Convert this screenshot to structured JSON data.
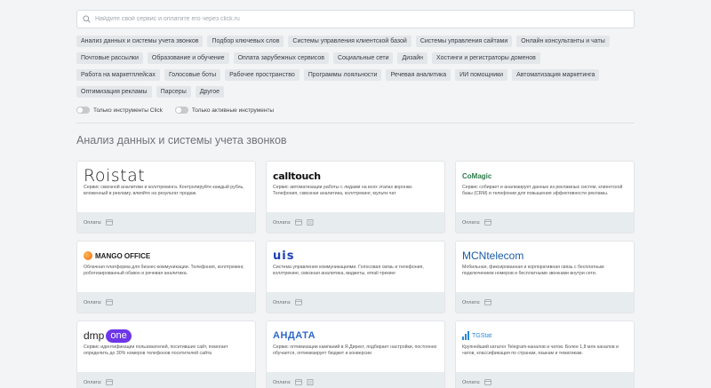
{
  "search": {
    "placeholder": "Найдите свой сервис и оплатите его через click.ru"
  },
  "tags": [
    "Анализ данных и системы учета звонков",
    "Подбор ключевых слов",
    "Системы управления клиентской базой",
    "Системы управления сайтами",
    "Онлайн консультанты и чаты",
    "Почтовые рассылки",
    "Образование и обучение",
    "Оплата зарубежных сервисов",
    "Социальные сети",
    "Дизайн",
    "Хостинги и регистраторы доменов",
    "Работа на маркетплейсах",
    "Голосовые боты",
    "Рабочее пространство",
    "Программы лояльности",
    "Речевая аналитика",
    "ИИ помощники",
    "Автоматизация маркетинга",
    "Оптимизация рекламы",
    "Парсеры",
    "Другое"
  ],
  "toggles": {
    "click_only": "Только инструменты Click",
    "active_only": "Только активные инструменты"
  },
  "section_title": "Анализ данных и системы учета звонков",
  "pay_label": "Оплата:",
  "cards": [
    {
      "logo": "Roistat",
      "desc": "Сервис сквозной аналитики и коллтрекинга. Контролируйте каждый рубль, вложенный в рекламу, влияйте на результат продаж."
    },
    {
      "logo": "calltouch",
      "desc": "Сервис автоматизации работы с лидами на всех этапах воронки. Телефония, сквозная аналитика, коллтрекинг, мульти-чат"
    },
    {
      "logo": "CoMagic",
      "desc": "Сервис собирает и анализирует данные из рекламных систем, клиентской базы (CRM) и телефонии для повышения эффективности рекламы."
    },
    {
      "logo": "MANGO OFFICE",
      "desc": "Облачная платформа для бизнес-коммуникации. Телефония, коллтрекинг, роботизированный обзвон и речевая аналитика."
    },
    {
      "logo": "uis",
      "desc": "Система управления коммуникациями. Голосовая связь и телефония, коллтрекинг, сквозная аналитика, виджеты, email-трекинг"
    },
    {
      "logo": "MCNtelecom",
      "desc": "Мобильная, фиксированная и корпоративная связь с бесплатным подключением номеров и бесплатными звонками внутри сети."
    },
    {
      "logo": "dmp.one",
      "desc": "Сервис идентификации пользователей, посетивших сайт, помогает определить до 30% номеров телефонов посетителей сайта"
    },
    {
      "logo": "АНДАТА",
      "desc": "Сервис оптимизации кампаний в Я.Директ, подбирает настройки, постоянно обучается, оптимизирует бюджет и конверсии"
    },
    {
      "logo": "TGStat",
      "desc": "Крупнейший каталог Telegram-каналов и чатов. Более 1,8 млн каналов и чатов, классификация по странам, языкам и тематикам."
    }
  ]
}
